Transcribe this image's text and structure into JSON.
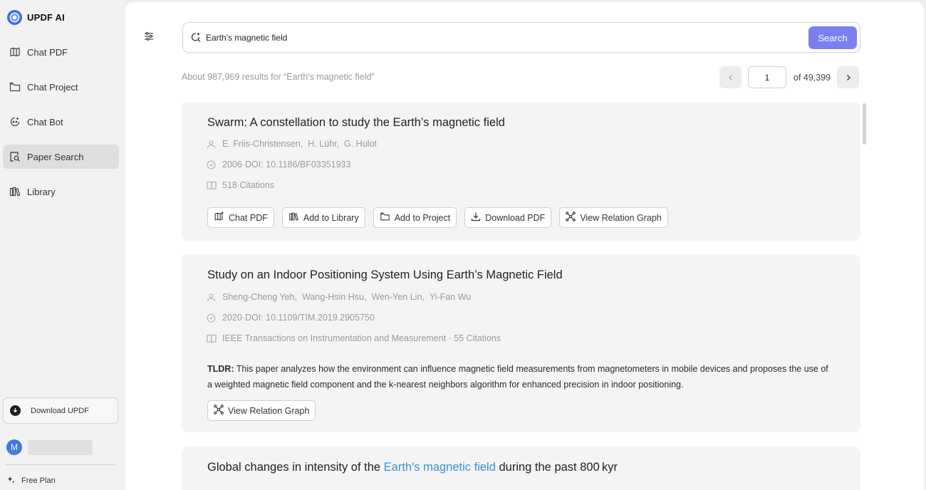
{
  "app": {
    "name": "UPDF AI"
  },
  "sidebar": {
    "items": [
      {
        "label": "Chat PDF",
        "icon": "chat-pdf-icon"
      },
      {
        "label": "Chat Project",
        "icon": "chat-project-icon"
      },
      {
        "label": "Chat Bot",
        "icon": "chat-bot-icon"
      },
      {
        "label": "Paper Search",
        "icon": "paper-search-icon",
        "active": true
      },
      {
        "label": "Library",
        "icon": "library-icon"
      }
    ],
    "download_label": "Download UPDF",
    "user": {
      "initial": "M"
    },
    "plan_label": "Free Plan"
  },
  "search": {
    "query": "Earth's magnetic field",
    "button_label": "Search"
  },
  "results": {
    "summary": "About 987,969 results for “Earth's magnetic field”",
    "pager": {
      "current": "1",
      "total_label": "of 49,399"
    }
  },
  "papers": [
    {
      "title": "Swarm: A constellation to study the Earth’s magnetic field",
      "authors": [
        "E. Friis-Christensen,",
        "H. Lühr,",
        "G. Hulot"
      ],
      "date_doi": "2006·DOI: 10.1186/BF03351933",
      "source": "518 Citations",
      "actions": {
        "chat_pdf": "Chat PDF",
        "add_library": "Add to Library",
        "add_project": "Add to Project",
        "download_pdf": "Download PDF",
        "relation_graph": "View Relation Graph"
      }
    },
    {
      "title": "Study on an Indoor Positioning System Using Earth’s Magnetic Field",
      "authors": [
        "Sheng-Cheng Yeh,",
        "Wang-Hsin Hsu,",
        "Wen-Yen Lin,",
        "Yi-Fan Wu"
      ],
      "date_doi": "2020·DOI: 10.1109/TIM.2019.2905750",
      "source": "IEEE Transactions on Instrumentation and Measurement · 55 Citations",
      "tldr_label": "TLDR:",
      "tldr_text": " This paper analyzes how the environment can influence magnetic field measurements from magnetometers in mobile devices and proposes the use of a weighted magnetic field component and the k-nearest neighbors algorithm for enhanced precision in indoor positioning.",
      "actions": {
        "relation_graph": "View Relation Graph"
      }
    },
    {
      "title_before": "Global changes in intensity of the ",
      "title_highlight": "Earth's magnetic field",
      "title_after": " during the past 800 kyr"
    }
  ],
  "colors": {
    "accent": "#7b7ff0",
    "highlight": "#3a8fd6",
    "active_nav": "#dedede"
  }
}
